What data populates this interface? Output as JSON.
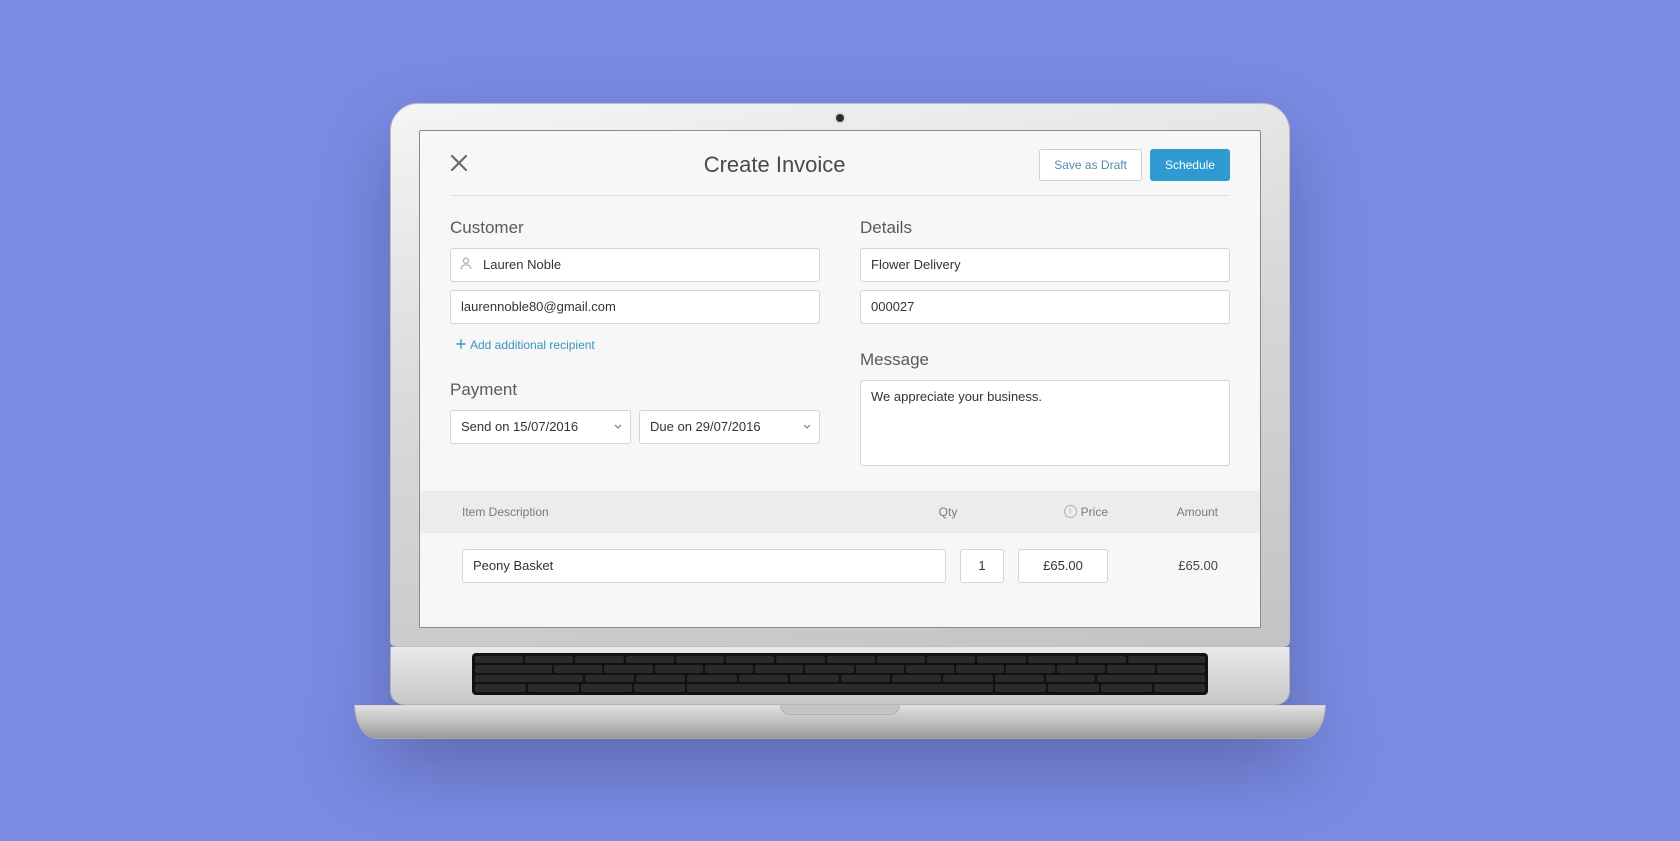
{
  "header": {
    "title": "Create Invoice",
    "save_draft_label": "Save as Draft",
    "schedule_label": "Schedule"
  },
  "customer": {
    "heading": "Customer",
    "name": "Lauren Noble",
    "email": "laurennoble80@gmail.com",
    "add_recipient_label": "Add additional recipient"
  },
  "details": {
    "heading": "Details",
    "description": "Flower Delivery",
    "invoice_number": "000027"
  },
  "payment": {
    "heading": "Payment",
    "send_label": "Send on 15/07/2016",
    "due_label": "Due on 29/07/2016"
  },
  "message": {
    "heading": "Message",
    "text": "We appreciate your business."
  },
  "items": {
    "head": {
      "desc": "Item Description",
      "qty": "Qty",
      "price": "Price",
      "amount": "Amount"
    },
    "rows": [
      {
        "desc": "Peony Basket",
        "qty": "1",
        "price": "£65.00",
        "amount": "£65.00"
      }
    ]
  },
  "colors": {
    "accent": "#2f9ad1"
  }
}
